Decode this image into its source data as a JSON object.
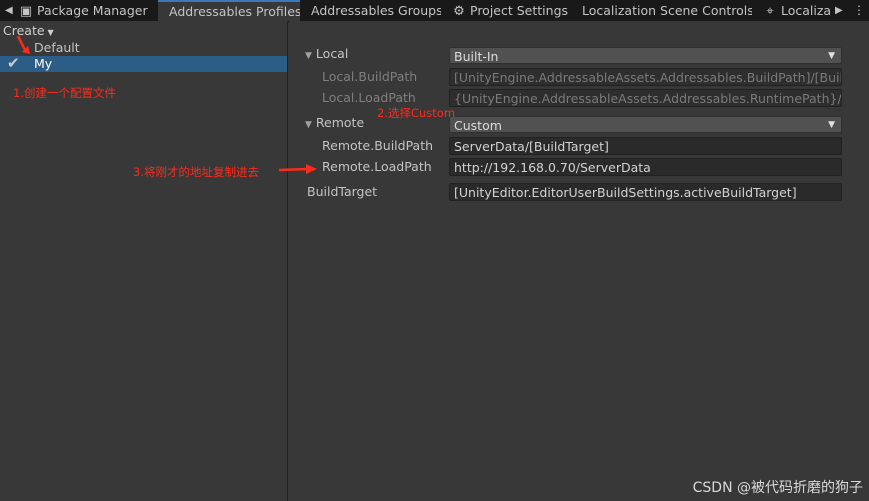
{
  "tabs": [
    {
      "label": "Package Manager",
      "icon": "package-icon"
    },
    {
      "label": "Addressables Profiles",
      "active": true
    },
    {
      "label": "Addressables Groups"
    },
    {
      "label": "Project Settings",
      "icon": "gear-icon"
    },
    {
      "label": "Localization Scene Controls"
    },
    {
      "label": "Localiza",
      "icon": "globe-icon"
    }
  ],
  "toolbar": {
    "create_label": "Create"
  },
  "profiles": [
    {
      "name": "Default"
    },
    {
      "name": "My",
      "selected": true
    }
  ],
  "settings": {
    "local": {
      "label": "Local",
      "value": "Built-In",
      "build_path_label": "Local.BuildPath",
      "build_path_value": "[UnityEngine.AddressableAssets.Addressables.BuildPath]/[BuildTarget]",
      "load_path_label": "Local.LoadPath",
      "load_path_value": "{UnityEngine.AddressableAssets.Addressables.RuntimePath}/[BuildTarget]"
    },
    "remote": {
      "label": "Remote",
      "value": "Custom",
      "build_path_label": "Remote.BuildPath",
      "build_path_value": "ServerData/[BuildTarget]",
      "load_path_label": "Remote.LoadPath",
      "load_path_value": "http://192.168.0.70/ServerData"
    },
    "build_target": {
      "label": "BuildTarget",
      "value": "[UnityEditor.EditorUserBuildSettings.activeBuildTarget]"
    }
  },
  "annotations": {
    "step1": "1.创建一个配置文件",
    "step2": "2.选择Custom",
    "step3": "3.将刚才的地址复制进去",
    "color": "#ff2a1a"
  },
  "watermark": "CSDN @被代码折磨的狗子"
}
